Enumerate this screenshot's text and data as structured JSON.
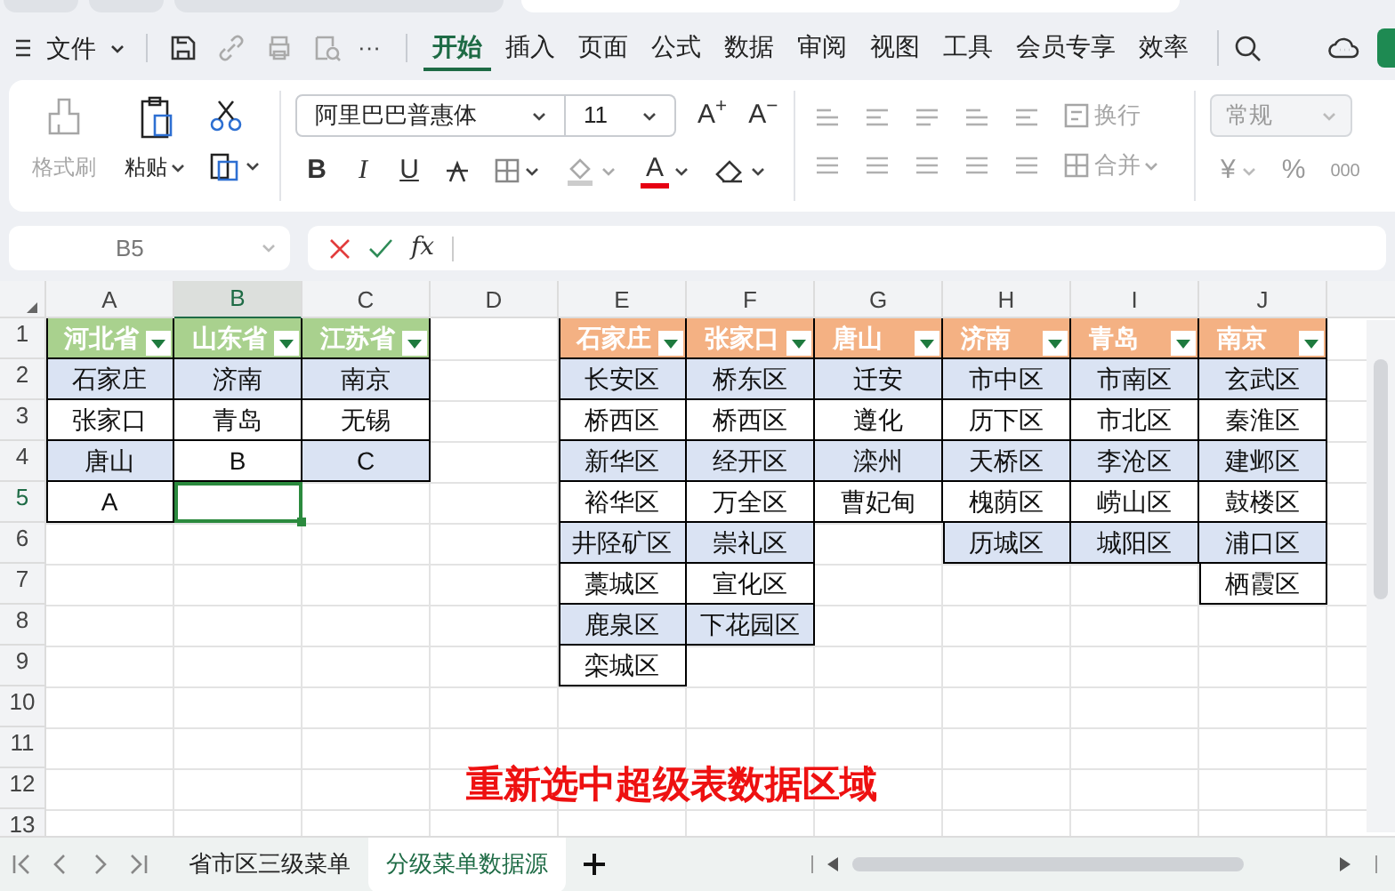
{
  "title_tabs": [
    {
      "selected": false
    },
    {
      "selected": false
    },
    {
      "selected": false
    },
    {
      "selected": true
    }
  ],
  "menu": {
    "file": "文件",
    "more": "···",
    "tabs": [
      {
        "label": "开始",
        "selected": true
      },
      {
        "label": "插入",
        "selected": false
      },
      {
        "label": "页面",
        "selected": false
      },
      {
        "label": "公式",
        "selected": false
      },
      {
        "label": "数据",
        "selected": false
      },
      {
        "label": "审阅",
        "selected": false
      },
      {
        "label": "视图",
        "selected": false
      },
      {
        "label": "工具",
        "selected": false
      },
      {
        "label": "会员专享",
        "selected": false
      },
      {
        "label": "效率",
        "selected": false
      }
    ]
  },
  "ribbon": {
    "format_painter": {
      "label": "格式刷",
      "disabled": true
    },
    "paste": {
      "label": "粘贴"
    },
    "font_name": "阿里巴巴普惠体",
    "font_size": "11",
    "grow": "A$^{+}$",
    "shrink": "A$^{−}$",
    "bold": "B",
    "italic": "I",
    "underline": "U",
    "font_color": "A",
    "wrap": {
      "label": "换行",
      "disabled": true
    },
    "merge": {
      "label": "合并",
      "disabled": true
    },
    "number_format": {
      "value": "常规",
      "disabled": true
    },
    "currency": "¥",
    "percent": "%",
    "thousands": "000"
  },
  "formula_bar": {
    "name_box": "B5",
    "fx": "fx"
  },
  "sheet": {
    "columns": [
      {
        "label": "A",
        "selected": false
      },
      {
        "label": "B",
        "selected": true
      },
      {
        "label": "C",
        "selected": false
      },
      {
        "label": "D",
        "selected": false
      },
      {
        "label": "E",
        "selected": false
      },
      {
        "label": "F",
        "selected": false
      },
      {
        "label": "G",
        "selected": false
      },
      {
        "label": "H",
        "selected": false
      },
      {
        "label": "I",
        "selected": false
      },
      {
        "label": "J",
        "selected": false
      }
    ],
    "rows": [
      {
        "label": "1",
        "selected": false,
        "cells": {
          "A": {
            "text": "河北省",
            "kind": "header_green",
            "selected": false
          },
          "B": {
            "text": "山东省",
            "kind": "header_green",
            "selected": false
          },
          "C": {
            "text": "江苏省",
            "kind": "header_green",
            "selected": false
          },
          "E": {
            "text": "石家庄",
            "kind": "header_orange",
            "selected": false
          },
          "F": {
            "text": "张家口",
            "kind": "header_orange",
            "selected": false
          },
          "G": {
            "text": "唐山",
            "kind": "header_orange",
            "selected": false
          },
          "H": {
            "text": "济南",
            "kind": "header_orange",
            "selected": false
          },
          "I": {
            "text": "青岛",
            "kind": "header_orange",
            "selected": false
          },
          "J": {
            "text": "南京",
            "kind": "header_orange",
            "selected": false
          }
        }
      },
      {
        "label": "2",
        "selected": false,
        "cells": {
          "A": {
            "text": "石家庄",
            "kind": "band",
            "selected": false
          },
          "B": {
            "text": "济南",
            "kind": "band",
            "selected": false
          },
          "C": {
            "text": "南京",
            "kind": "band",
            "selected": false
          },
          "E": {
            "text": "长安区",
            "kind": "band",
            "selected": false
          },
          "F": {
            "text": "桥东区",
            "kind": "band",
            "selected": false
          },
          "G": {
            "text": "迁安",
            "kind": "band",
            "selected": false
          },
          "H": {
            "text": "市中区",
            "kind": "band",
            "selected": false
          },
          "I": {
            "text": "市南区",
            "kind": "band",
            "selected": false
          },
          "J": {
            "text": "玄武区",
            "kind": "band",
            "selected": false
          }
        }
      },
      {
        "label": "3",
        "selected": false,
        "cells": {
          "A": {
            "text": "张家口",
            "kind": "plain",
            "selected": false
          },
          "B": {
            "text": "青岛",
            "kind": "plain",
            "selected": false
          },
          "C": {
            "text": "无锡",
            "kind": "plain",
            "selected": false
          },
          "E": {
            "text": "桥西区",
            "kind": "plain",
            "selected": false
          },
          "F": {
            "text": "桥西区",
            "kind": "plain",
            "selected": false
          },
          "G": {
            "text": "遵化",
            "kind": "plain",
            "selected": false
          },
          "H": {
            "text": "历下区",
            "kind": "plain",
            "selected": false
          },
          "I": {
            "text": "市北区",
            "kind": "plain",
            "selected": false
          },
          "J": {
            "text": "秦淮区",
            "kind": "plain",
            "selected": false
          }
        }
      },
      {
        "label": "4",
        "selected": false,
        "cells": {
          "A": {
            "text": "唐山",
            "kind": "band",
            "selected": false
          },
          "B": {
            "text": "B",
            "kind": "plain",
            "selected": false
          },
          "C": {
            "text": "C",
            "kind": "band",
            "selected": false
          },
          "E": {
            "text": "新华区",
            "kind": "band",
            "selected": false
          },
          "F": {
            "text": "经开区",
            "kind": "band",
            "selected": false
          },
          "G": {
            "text": "滦州",
            "kind": "band",
            "selected": false
          },
          "H": {
            "text": "天桥区",
            "kind": "band",
            "selected": false
          },
          "I": {
            "text": "李沧区",
            "kind": "band",
            "selected": false
          },
          "J": {
            "text": "建邺区",
            "kind": "band",
            "selected": false
          }
        }
      },
      {
        "label": "5",
        "selected": true,
        "cells": {
          "A": {
            "text": "A",
            "kind": "plain",
            "selected": false
          },
          "B": {
            "kind": "blank",
            "selected": true
          },
          "E": {
            "text": "裕华区",
            "kind": "plain",
            "selected": false
          },
          "F": {
            "text": "万全区",
            "kind": "plain",
            "selected": false
          },
          "G": {
            "text": "曹妃甸",
            "kind": "plain",
            "selected": false
          },
          "H": {
            "text": "槐荫区",
            "kind": "plain",
            "selected": false
          },
          "I": {
            "text": "崂山区",
            "kind": "plain",
            "selected": false
          },
          "J": {
            "text": "鼓楼区",
            "kind": "plain",
            "selected": false
          }
        }
      },
      {
        "label": "6",
        "selected": false,
        "cells": {
          "E": {
            "text": "井陉矿区",
            "kind": "band",
            "selected": false
          },
          "F": {
            "text": "崇礼区",
            "kind": "band",
            "selected": false
          },
          "H": {
            "text": "历城区",
            "kind": "band",
            "selected": false
          },
          "I": {
            "text": "城阳区",
            "kind": "band",
            "selected": false
          },
          "J": {
            "text": "浦口区",
            "kind": "band",
            "selected": false
          }
        }
      },
      {
        "label": "7",
        "selected": false,
        "cells": {
          "E": {
            "text": "藁城区",
            "kind": "plain",
            "selected": false
          },
          "F": {
            "text": "宣化区",
            "kind": "plain",
            "selected": false
          },
          "J": {
            "text": "栖霞区",
            "kind": "plain",
            "selected": false
          }
        }
      },
      {
        "label": "8",
        "selected": false,
        "cells": {
          "E": {
            "text": "鹿泉区",
            "kind": "band",
            "selected": false
          },
          "F": {
            "text": "下花园区",
            "kind": "band",
            "selected": false
          }
        }
      },
      {
        "label": "9",
        "selected": false,
        "cells": {
          "E": {
            "text": "栾城区",
            "kind": "plain",
            "selected": false
          }
        }
      },
      {
        "label": "10",
        "selected": false,
        "cells": {}
      },
      {
        "label": "11",
        "selected": false,
        "cells": {}
      },
      {
        "label": "12",
        "selected": false,
        "cells": {}
      },
      {
        "label": "13",
        "selected": false,
        "cells": {}
      }
    ],
    "annotation": "重新选中超级表数据区域"
  },
  "sheet_tabs": [
    {
      "label": "省市区三级菜单",
      "selected": false
    },
    {
      "label": "分级菜单数据源",
      "selected": true
    }
  ]
}
